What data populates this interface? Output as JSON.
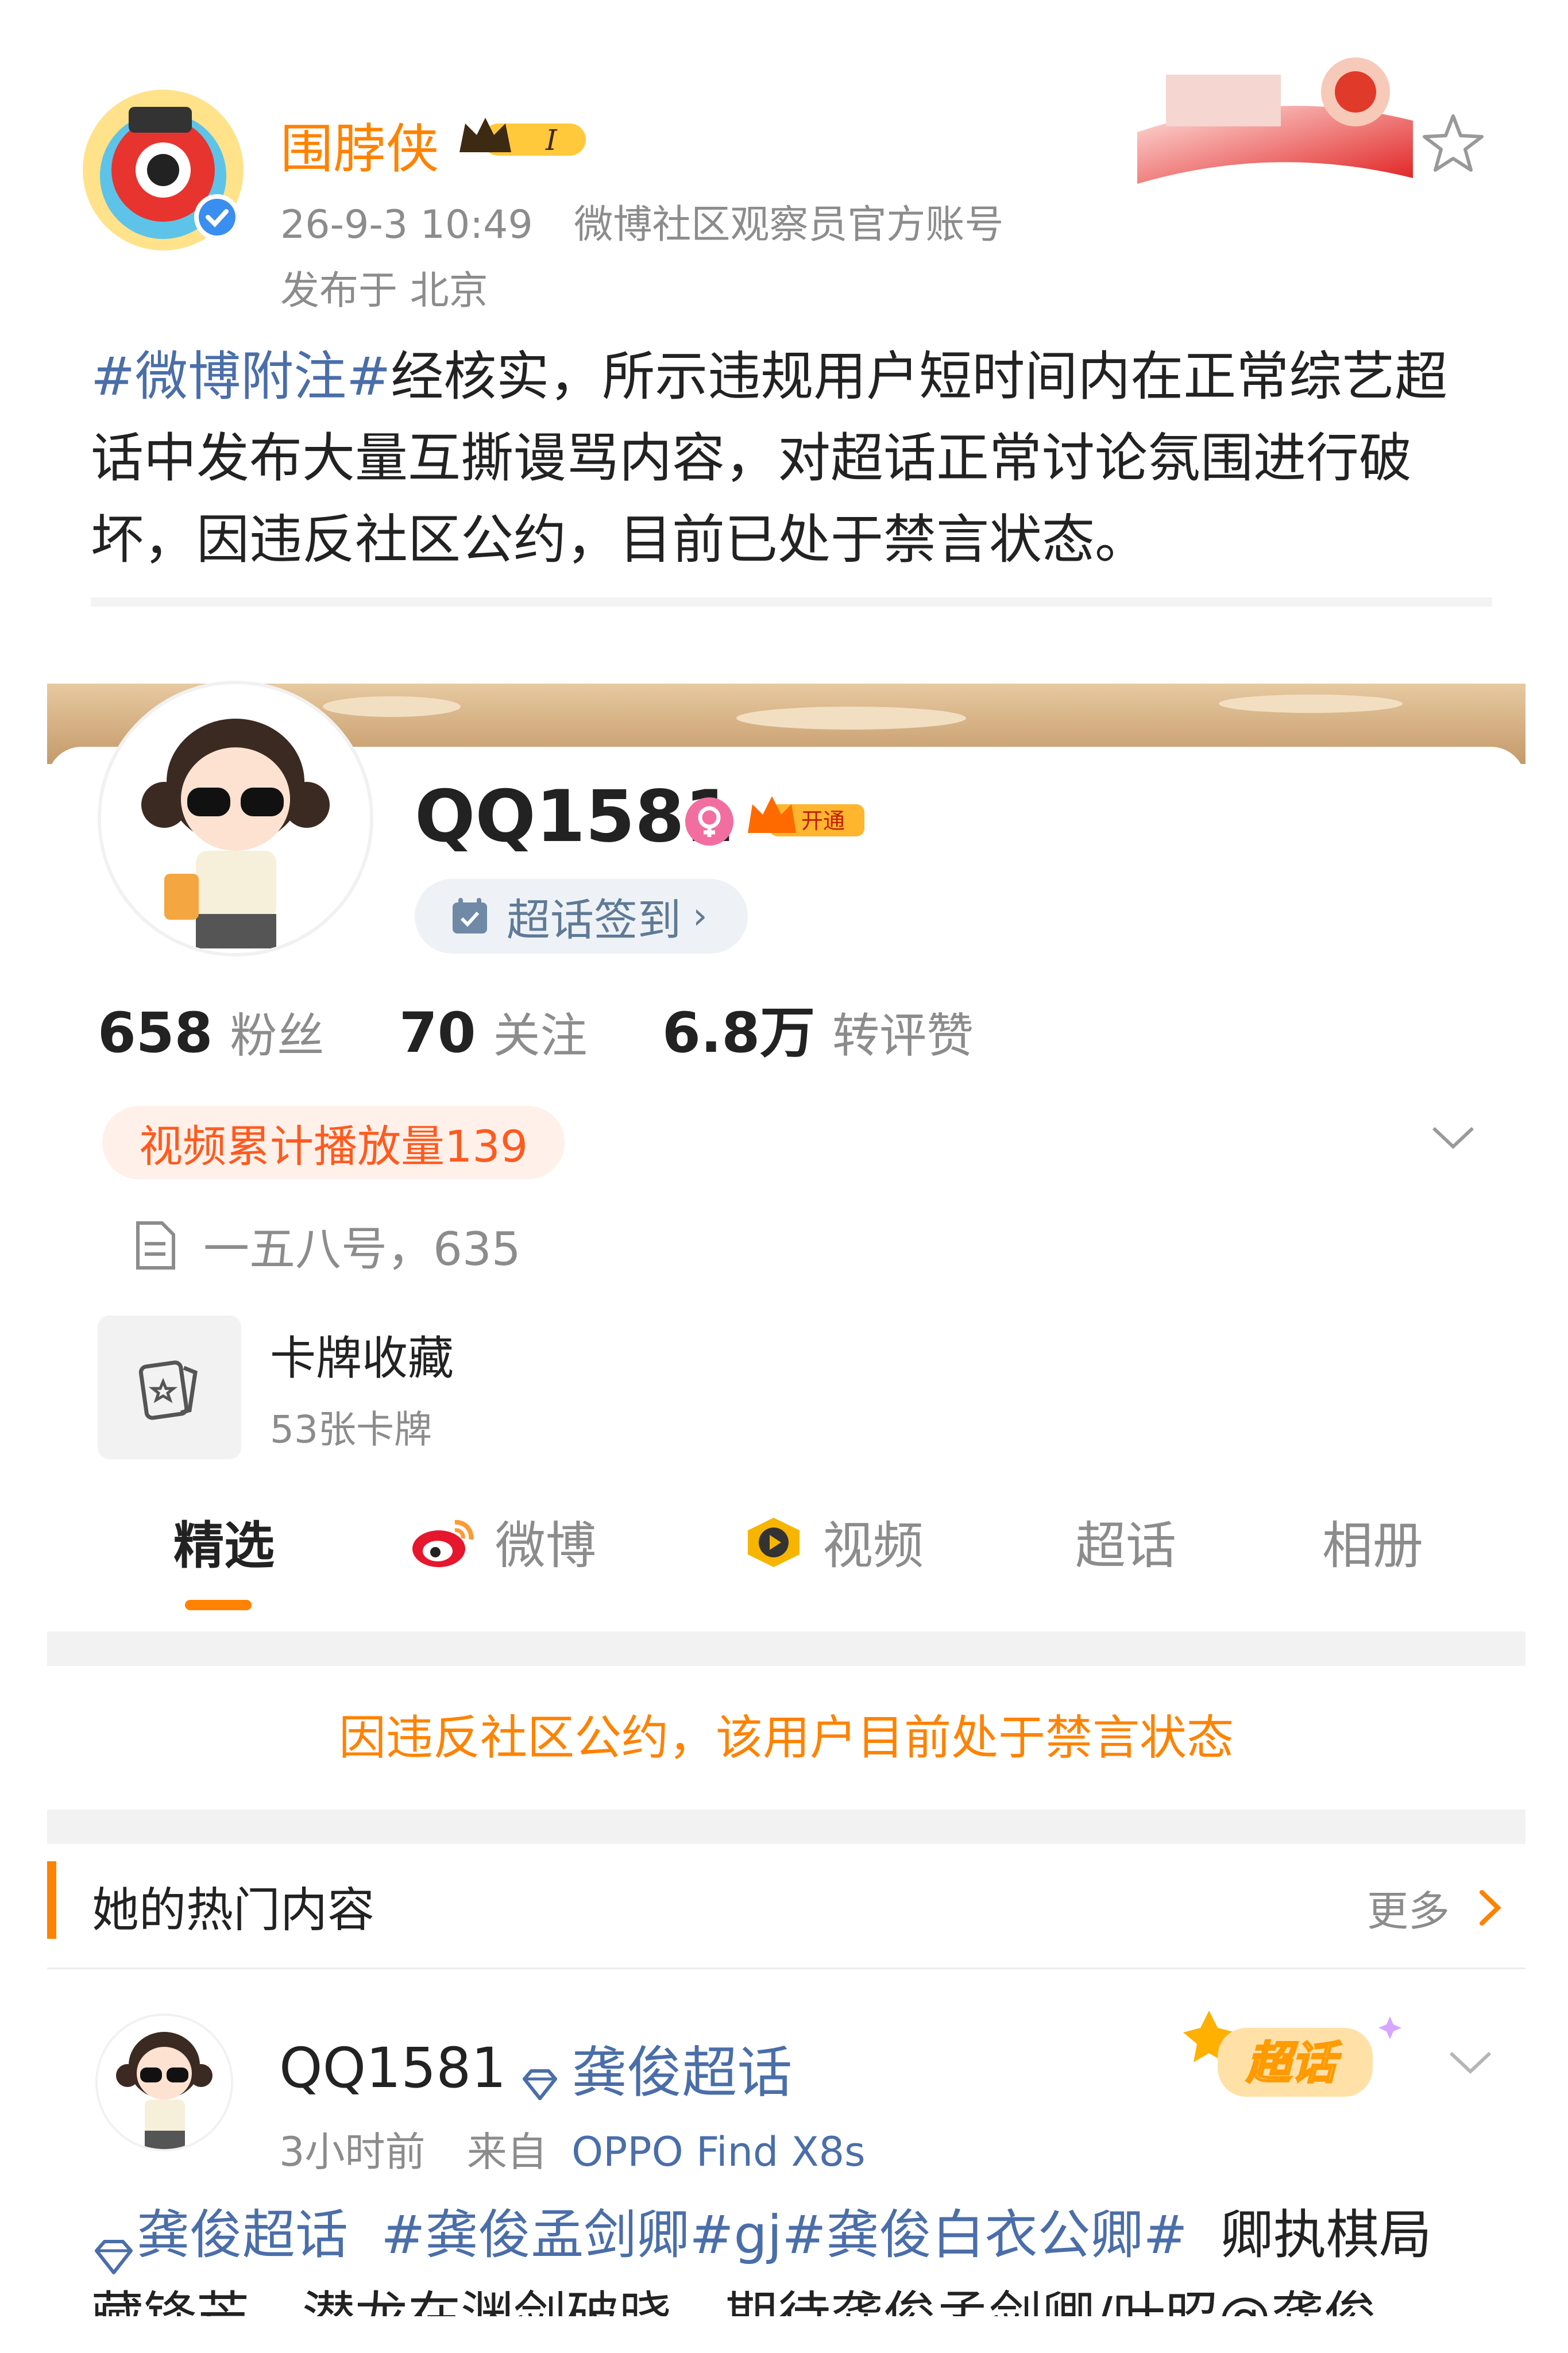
{
  "post": {
    "author": "围脖侠",
    "level_badge": "I",
    "time": "26-9-3 10:49",
    "source": "微博社区观察员官方账号",
    "location": "发布于 北京",
    "hashtag": "#微博附注#",
    "text": "经核实，所示违规用户短时间内在正常综艺超话中发布大量互撕谩骂内容，对超话正常讨论氛围进行破坏，因违反社区公约，目前已处于禁言状态。"
  },
  "profile": {
    "name": "QQ1581",
    "vip_label": "开通",
    "checkin_label": "超话签到",
    "stats": [
      {
        "num": "658",
        "label": "粉丝"
      },
      {
        "num": "70",
        "label": "关注"
      },
      {
        "num": "6.8万",
        "label": "转评赞"
      }
    ],
    "video_badge": "视频累计播放量139",
    "bio": "一五八号，635",
    "cards_title": "卡牌收藏",
    "cards_count": "53张卡牌",
    "tabs": [
      "精选",
      "微博",
      "视频",
      "超话",
      "相册"
    ],
    "notice": "因违反社区公约，该用户目前处于禁言状态",
    "hot_title": "她的热门内容",
    "hot_more": "更多"
  },
  "feed": {
    "name": "QQ1581",
    "topic": "龚俊超话",
    "time": "3小时前",
    "from_label": "来自",
    "device": "OPPO Find X8s",
    "badge_text": "超话",
    "topic_prefix": "龚俊超话",
    "tags": "#龚俊孟剑卿#gj#龚俊白衣公卿#",
    "text_tail": "卿执棋局",
    "line2": "藏锋芒，潜龙在渊剑破晓，期待龚俊孟剑卿/叶昭@龚俊"
  },
  "colors": {
    "accent": "#ff8200",
    "link": "#4a6ea9",
    "muted": "#8c8c8c"
  },
  "icons": [
    "star-outline-icon",
    "verified-icon",
    "crown-icon",
    "female-icon",
    "calendar-check-icon",
    "chevron-down-icon",
    "document-icon",
    "card-icon",
    "weibo-icon",
    "video-icon",
    "chevron-right-icon",
    "diamond-icon"
  ]
}
